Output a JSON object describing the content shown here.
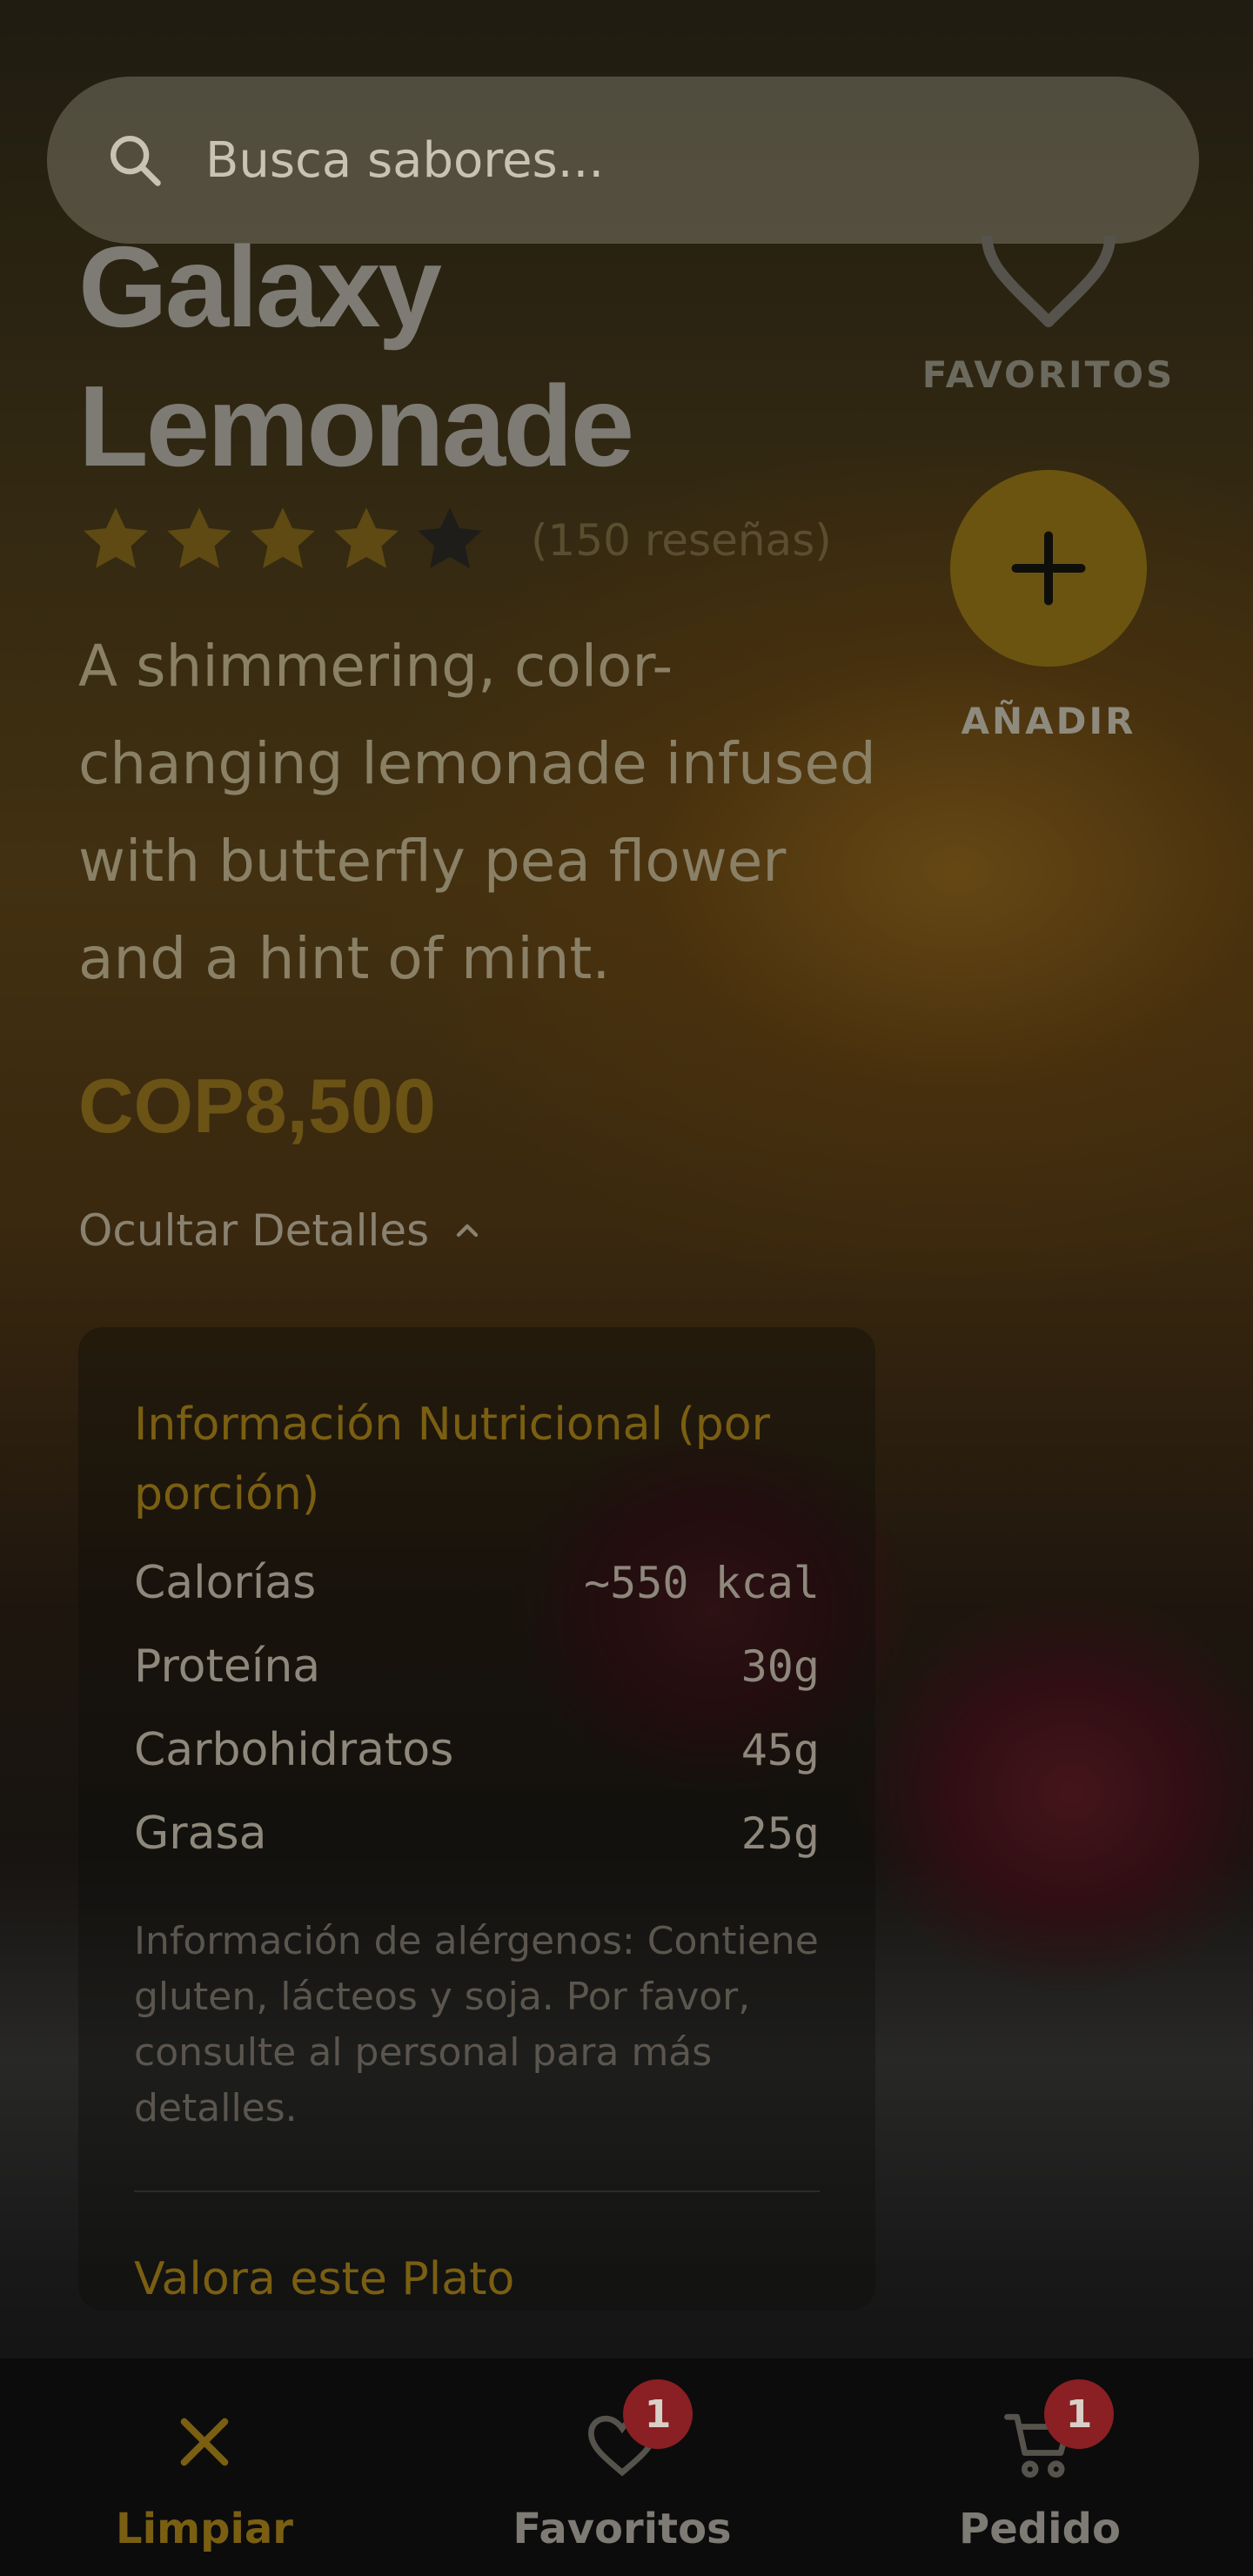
{
  "search": {
    "placeholder": "Busca sabores..."
  },
  "product": {
    "title": "Galaxy Lemonade",
    "rating_value": 4,
    "rating_max": 5,
    "review_count_label": "(150 reseñas)",
    "description": "A shimmering, color-changing lemonade infused with butterfly pea flower and a hint of mint.",
    "price": "COP8,500"
  },
  "side_actions": {
    "favorites_label": "FAVORITOS",
    "add_label": "AÑADIR"
  },
  "details_toggle": {
    "label": "Ocultar Detalles"
  },
  "nutrition": {
    "title": "Información Nutricional (por porción)",
    "rows": [
      {
        "label": "Calorías",
        "value": "~550 kcal"
      },
      {
        "label": "Proteína",
        "value": "30g"
      },
      {
        "label": "Carbohidratos",
        "value": "45g"
      },
      {
        "label": "Grasa",
        "value": "25g"
      }
    ],
    "allergens": "Información de alérgenos: Contiene gluten, lácteos y soja. Por favor, consulte al personal para más detalles.",
    "rate_title": "Valora este Plato"
  },
  "bottom_nav": [
    {
      "label": "Limpiar",
      "icon": "close-icon",
      "active": true
    },
    {
      "label": "Favoritos",
      "icon": "heart-icon",
      "badge": "1"
    },
    {
      "label": "Pedido",
      "icon": "cart-icon",
      "badge": "1"
    }
  ],
  "colors": {
    "accent": "#6b540f",
    "accent_text": "#7a5f12",
    "active_nav": "#7a5f12",
    "badge": "#8a1f24",
    "nav_bg": "#0c0c0c"
  }
}
